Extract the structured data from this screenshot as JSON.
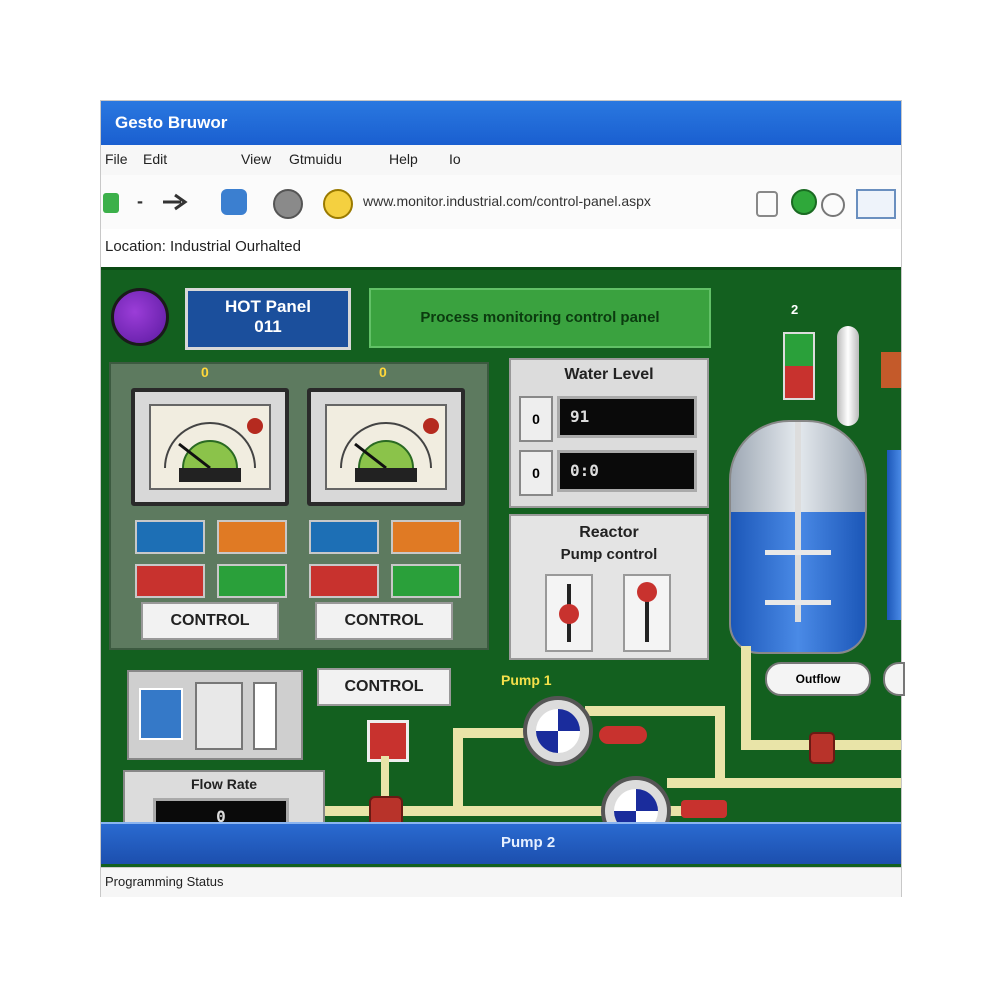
{
  "window": {
    "title": "Gesto Bruwor"
  },
  "menu": [
    {
      "label": "File"
    },
    {
      "label": "Edit"
    },
    {
      "label": "View"
    },
    {
      "label": "Gtmuidu"
    },
    {
      "label": "Help"
    },
    {
      "label": "Io"
    }
  ],
  "toolbar": {
    "back_label": "-",
    "address_text": "www.monitor.industrial.com/control-panel.aspx",
    "go_icon": "green-circle-icon"
  },
  "address_bar": {
    "text": "Location: Industrial  Ourhalted"
  },
  "scada": {
    "header_badge": {
      "line1": "HOT Panel",
      "line2": "011"
    },
    "banner": "Process monitoring control panel",
    "gauge_panels": [
      {
        "marker": "0",
        "button_text": "CONTROL",
        "buttons": [
          {
            "color": "#1d6fb5"
          },
          {
            "color": "#e07a24"
          },
          {
            "color": "#c8322e"
          },
          {
            "color": "#2aa03a"
          }
        ]
      },
      {
        "marker": "0",
        "button_text": "CONTROL",
        "buttons": [
          {
            "color": "#1d6fb5"
          },
          {
            "color": "#e07a24"
          },
          {
            "color": "#c8322e"
          },
          {
            "color": "#2aa03a"
          }
        ]
      }
    ],
    "water_level": {
      "title": "Water Level",
      "readouts": [
        {
          "tag": "0",
          "value": "91"
        },
        {
          "tag": "0",
          "value": "0:0"
        }
      ]
    },
    "reactor_panel": {
      "title": "Reactor",
      "subtitle": "Pump control"
    },
    "control_label": "CONTROL",
    "flow_label": "Pump 1",
    "flow_box": {
      "title": "Flow Rate",
      "value": "0"
    },
    "bottom_label": "Pump 2",
    "tank_top_label": "2",
    "tank_valve_label": "Outflow"
  },
  "status": {
    "text": "Programming Status"
  },
  "colors": {
    "panel_green": "#13601f",
    "title_blue": "#1a5fd0",
    "water_blue": "#1c57b8",
    "pipe_yellow": "#e9e4a8"
  }
}
